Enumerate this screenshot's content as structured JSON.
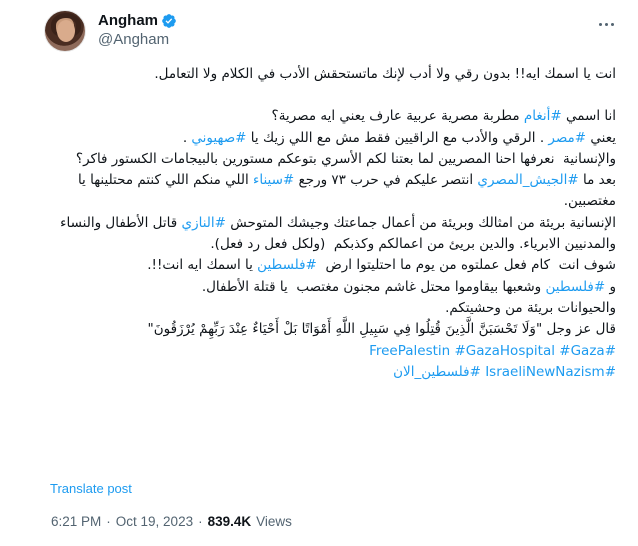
{
  "author": {
    "display_name": "Angham",
    "handle": "@Angham",
    "verified_icon": "verified-badge-icon"
  },
  "tweet_lines": [
    {
      "type": "p",
      "parts": [
        {
          "t": "انت يا اسمك ايه!! بدون رقي ولا أدب لإنك ماتستحقش الأدب في الكلام ولا التعامل."
        }
      ]
    },
    {
      "type": "gap"
    },
    {
      "type": "p",
      "parts": [
        {
          "t": "انا اسمي "
        },
        {
          "t": "#أنغام",
          "h": true
        },
        {
          "t": " مطربة مصرية عربية عارف يعني ايه مصرية؟"
        }
      ]
    },
    {
      "type": "p",
      "parts": [
        {
          "t": "يعني "
        },
        {
          "t": "#مصر",
          "h": true
        },
        {
          "t": " . الرقي والأدب مع الراقيين فقط مش مع اللي زيك يا "
        },
        {
          "t": "#صهيوني",
          "h": true
        },
        {
          "t": " ."
        }
      ]
    },
    {
      "type": "p",
      "parts": [
        {
          "t": "والإنسانية  نعرفها احنا المصريين لما بعتنا لكم الأسري بتوعكم مستورين بالبيجامات الكستور فاكر؟"
        }
      ]
    },
    {
      "type": "p",
      "parts": [
        {
          "t": "بعد ما "
        },
        {
          "t": "#الجيش_المصري",
          "h": true
        },
        {
          "t": " انتصر عليكم في حرب ٧٣ ورجع "
        },
        {
          "t": "#سيناء",
          "h": true
        },
        {
          "t": " اللي منكم اللي كنتم محتلينها يا مغتصبين."
        }
      ]
    },
    {
      "type": "p",
      "parts": [
        {
          "t": "الإنسانية بريئة من امثالك وبريئة من أعمال جماعتك وجيشك المتوحش "
        },
        {
          "t": "#النازي",
          "h": true
        },
        {
          "t": " قاتل الأطفال والنساء والمدنيين الابرياء. والدين بريئ من اعمالكم وكذبكم  (ولكل فعل رد فعل)."
        }
      ]
    },
    {
      "type": "p",
      "parts": [
        {
          "t": "شوف انت  كام فعل عملتوه من يوم ما احتليتوا ارض  "
        },
        {
          "t": "#فلسطين",
          "h": true
        },
        {
          "t": " يا اسمك ايه انت!!."
        }
      ]
    },
    {
      "type": "p",
      "parts": [
        {
          "t": "و "
        },
        {
          "t": "#فلسطين",
          "h": true
        },
        {
          "t": " وشعبها بيقاوموا محتل غاشم مجنون مغتصب  يا قتلة الأطفال."
        }
      ]
    },
    {
      "type": "p",
      "parts": [
        {
          "t": "والحيوانات بريئة من وحشيتكم."
        }
      ]
    },
    {
      "type": "p",
      "parts": [
        {
          "t": "قال عز وجل \"وَلَا تَحْسَبَنَّ الَّذِينَ قُتِلُوا فِي سَبِيلِ اللَّهِ أَمْوَاتًا بَلْ أَحْيَاءٌ عِنْدَ رَبِّهِمْ يُرْزَقُونَ\""
        }
      ]
    },
    {
      "type": "p",
      "parts": [
        {
          "t": "#FreePalestin #GazaHospital #Gaza",
          "h": true
        }
      ]
    },
    {
      "type": "p",
      "parts": [
        {
          "t": "#IsraeliNewNazism #فلسطين_الان",
          "h": true
        }
      ]
    }
  ],
  "translate_label": "Translate post",
  "meta": {
    "time": "6:21 PM",
    "separator": "·",
    "date": "Oct 19, 2023",
    "views_count": "839.4K",
    "views_label": "Views"
  },
  "colors": {
    "link": "#1d9bf0",
    "verified": "#1d9bf0",
    "secondary_text": "#536471"
  }
}
